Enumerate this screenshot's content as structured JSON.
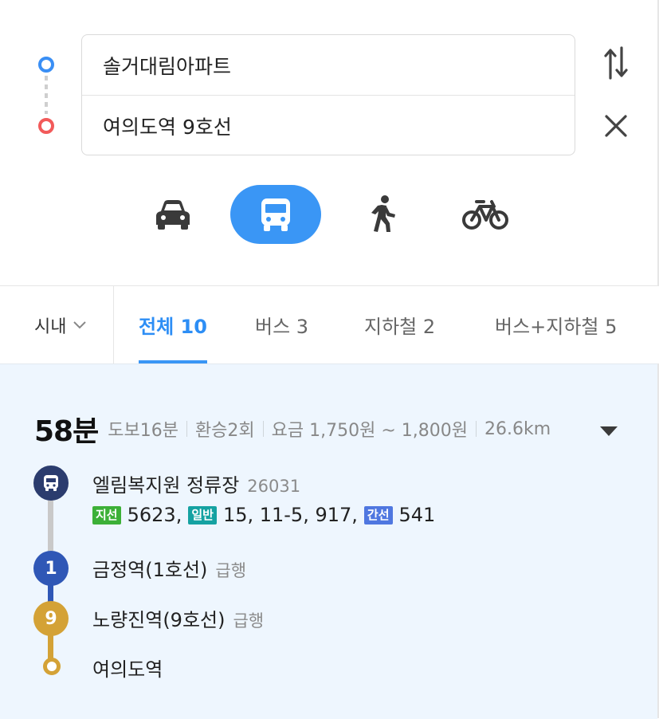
{
  "search": {
    "origin": "솔거대림아파트",
    "destination": "여의도역 9호선"
  },
  "icons": {
    "swap": "swap-arrows-icon",
    "close": "close-icon",
    "car": "car-icon",
    "bus": "bus-icon",
    "walk": "walking-person-icon",
    "bike": "bicycle-icon",
    "expand": "caret-down-icon"
  },
  "colors": {
    "accent": "#3a96f5",
    "origin_dot": "#3a8ff5",
    "destination_dot": "#f25a5a",
    "subway_line1": "#2f57b6",
    "subway_line9": "#d4a236",
    "bus_badge_branch": "#3cb037",
    "bus_badge_general": "#15a2a2",
    "bus_badge_trunk": "#4f77e0"
  },
  "tabs": {
    "region": "시내",
    "items": [
      {
        "label": "전체 10",
        "active": true
      },
      {
        "label": "버스 3",
        "active": false
      },
      {
        "label": "지하철 2",
        "active": false
      },
      {
        "label": "버스+지하철 5",
        "active": false
      }
    ]
  },
  "route": {
    "duration": "58분",
    "walk": "도보16분",
    "transfers": "환승2회",
    "fare": "요금 1,750원 ~ 1,800원",
    "distance": "26.6km",
    "steps": [
      {
        "name": "엘림복지원 정류장",
        "sub": "26031",
        "marker": "",
        "bus_groups": [
          {
            "badge": "지선",
            "routes": "5623,"
          },
          {
            "badge": "일반",
            "routes": "15, 11-5, 917,"
          },
          {
            "badge": "간선",
            "routes": "541"
          }
        ]
      },
      {
        "name": "금정역(1호선)",
        "sub": "급행",
        "marker": "1"
      },
      {
        "name": "노량진역(9호선)",
        "sub": "급행",
        "marker": "9"
      },
      {
        "name": "여의도역",
        "sub": "",
        "marker": ""
      }
    ]
  }
}
